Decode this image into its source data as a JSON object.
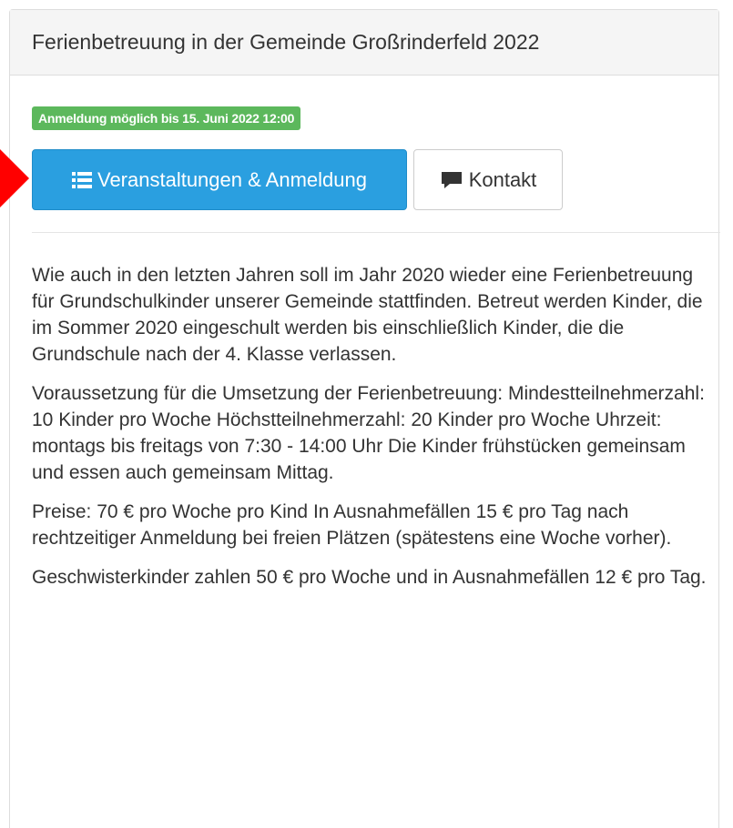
{
  "panel": {
    "title": "Ferienbetreuung in der Gemeinde Großrinderfeld 2022"
  },
  "registration_badge": "Anmeldung möglich bis 15. Juni 2022 12:00",
  "buttons": {
    "events_label": "Veranstaltungen & Anmeldung",
    "events_icon": "list-icon",
    "contact_label": "Kontakt",
    "contact_icon": "comment-icon"
  },
  "paragraphs": [
    "Wie auch in den letzten Jahren soll im Jahr 2020 wieder eine Ferienbetreuung für Grundschulkinder unserer Gemeinde stattfinden. Betreut werden Kinder, die im Sommer 2020 eingeschult werden bis einschließlich Kinder, die die Grundschule nach der 4. Klasse verlassen.",
    "Voraussetzung für die Umsetzung der Ferienbetreuung: Mindestteilnehmerzahl: 10 Kinder pro Woche Höchstteilnehmerzahl: 20 Kinder pro Woche Uhrzeit: montags bis freitags von 7:30 - 14:00 Uhr Die Kinder frühstücken gemeinsam und essen auch gemeinsam Mittag.",
    "Preise: 70 € pro Woche pro Kind In Ausnahmefällen 15 € pro Tag nach rechtzeitiger Anmeldung bei freien Plätzen (spätestens eine Woche vorher).",
    "Geschwisterkinder zahlen 50 € pro Woche und in Ausnahmefällen 12 € pro Tag."
  ],
  "colors": {
    "primary": "#2a9fe0",
    "badge": "#5cb85c",
    "pointer": "#ff0000"
  }
}
